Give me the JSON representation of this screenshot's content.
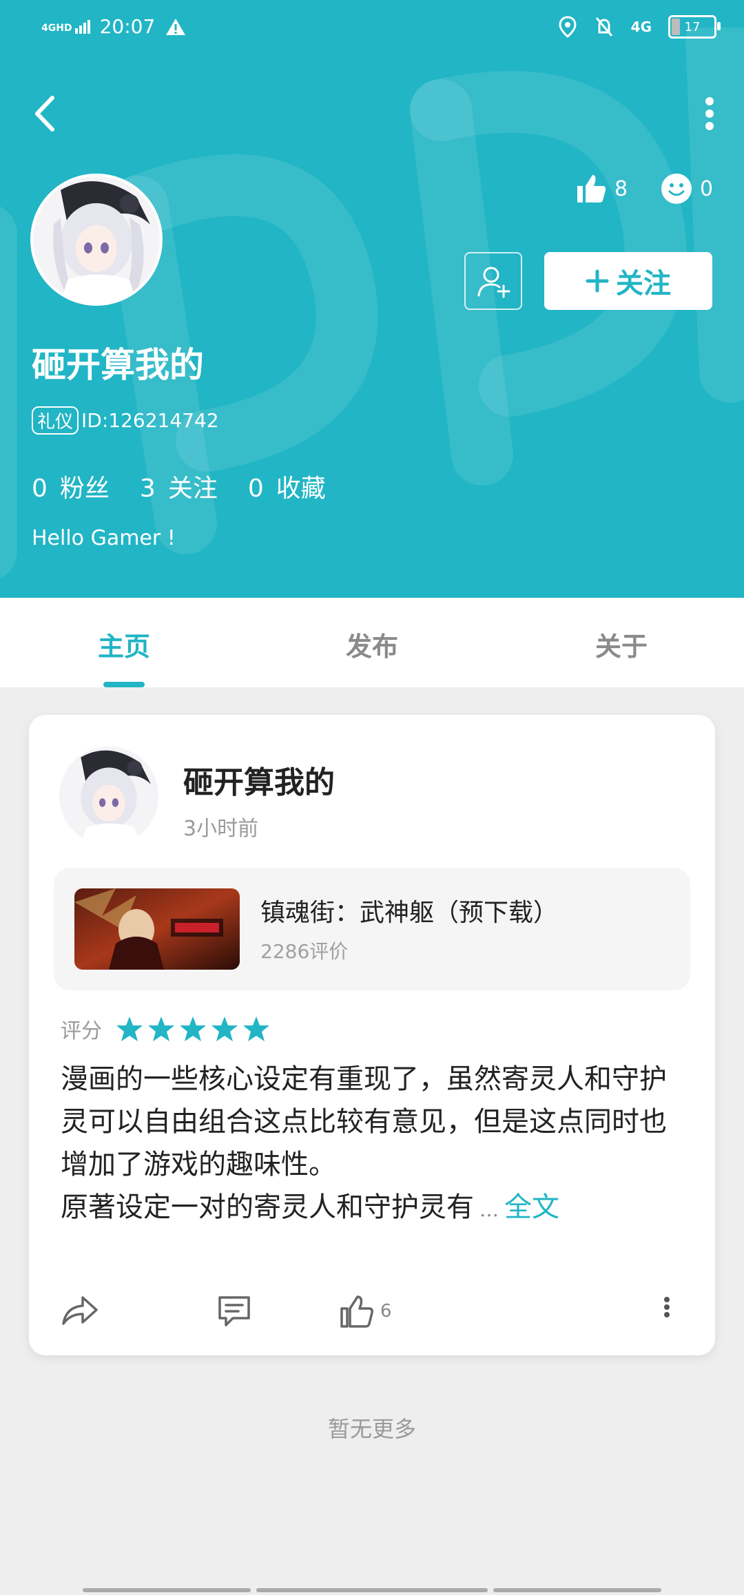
{
  "status_bar": {
    "network": "4GHD",
    "time": "20:07",
    "network_right": "4G",
    "battery": "17"
  },
  "profile": {
    "name": "砸开算我的",
    "badge": "礼仪",
    "id_text": "ID:126214742",
    "likes": "8",
    "smiles": "0",
    "follow_label": "关注",
    "stats": [
      {
        "num": "0",
        "label": "粉丝"
      },
      {
        "num": "3",
        "label": "关注"
      },
      {
        "num": "0",
        "label": "收藏"
      }
    ],
    "bio": "Hello Gamer !"
  },
  "tabs": [
    "主页",
    "发布",
    "关于"
  ],
  "active_tab": 0,
  "post": {
    "author": "砸开算我的",
    "time": "3小时前",
    "game": {
      "title": "镇魂街：武神躯（预下载）",
      "reviews": "2286评价"
    },
    "rating_label": "评分",
    "rating": 5,
    "review_text": "漫画的一些核心设定有重现了，虽然寄灵人和守护灵可以自由组合这点比较有意见，但是这点同时也增加了游戏的趣味性。\n原著设定一对的寄灵人和守护灵有",
    "ellipsis": "…",
    "fulltext_label": "全文",
    "like_count": "6"
  },
  "footer": "暂无更多",
  "colors": {
    "accent": "#21b5c5",
    "background": "#eeeeee"
  }
}
